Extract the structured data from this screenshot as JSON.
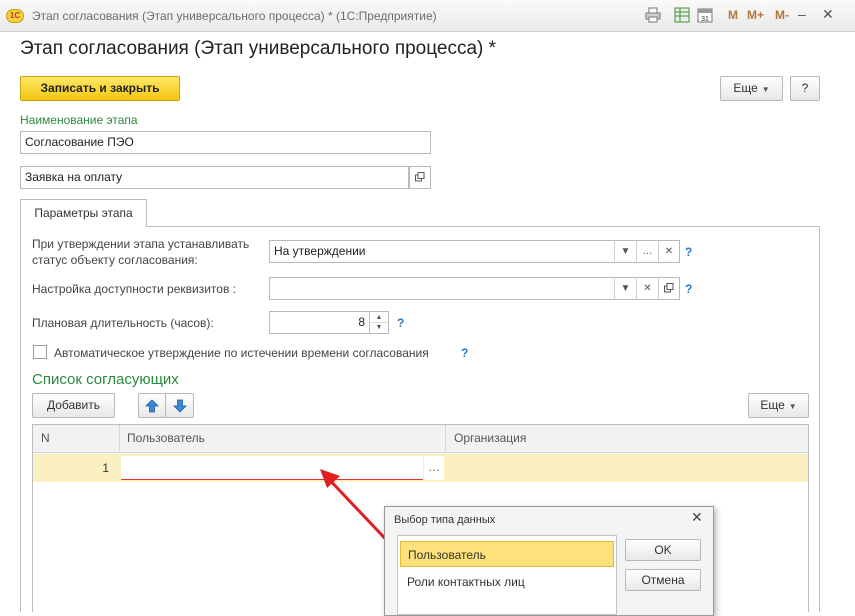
{
  "window": {
    "logo_text": "1С",
    "title": "Этап согласования (Этап универсального процесса) * (1С:Предприятие)",
    "calendar_day": "31",
    "memory_buttons": [
      "M",
      "M+",
      "M-"
    ],
    "controls": {
      "minimize": "–",
      "close": "✕"
    }
  },
  "form": {
    "title": "Этап согласования (Этап универсального процесса) *",
    "save_close_label": "Записать и закрыть",
    "more_label": "Еще",
    "help_label": "?",
    "name_label": "Наименование этапа",
    "name_value": "Согласование ПЭО",
    "process_value": "Заявка на оплату"
  },
  "tabs": [
    {
      "label": "Параметры этапа"
    }
  ],
  "params": {
    "status_label_line1": "При утверждении этапа устанавливать",
    "status_label_line2": "статус объекту согласования:",
    "status_value": "На утверждении",
    "access_label": "Настройка доступности реквизитов :",
    "access_value": "",
    "duration_label": "Плановая длительность (часов):",
    "duration_value": "8",
    "auto_approve_label": "Автоматическое утверждение по истечении времени согласования",
    "auto_approve_checked": false,
    "help_mark": "?"
  },
  "approvers": {
    "heading": "Список согласующих",
    "add_label": "Добавить",
    "more_label": "Еще",
    "columns": [
      "N",
      "Пользователь",
      "Организация"
    ],
    "rows": [
      {
        "n": "1",
        "user": "",
        "organization": ""
      }
    ]
  },
  "popup": {
    "title": "Выбор типа данных",
    "close": "✕",
    "options": [
      "Пользователь",
      "Роли контактных лиц"
    ],
    "selected_index": 0,
    "ok_label": "OK",
    "cancel_label": "Отмена"
  },
  "colors": {
    "accent_green": "#2a8a3c",
    "save_button": "#f2c711",
    "selected_row": "#fbf0c2",
    "annotation_arrow": "#e02020"
  },
  "icons": [
    "print-icon",
    "spreadsheet-icon",
    "calendar-icon",
    "dropdown-icon",
    "ellipsis-icon",
    "clear-icon",
    "open-icon",
    "arrow-up-icon",
    "arrow-down-icon"
  ]
}
